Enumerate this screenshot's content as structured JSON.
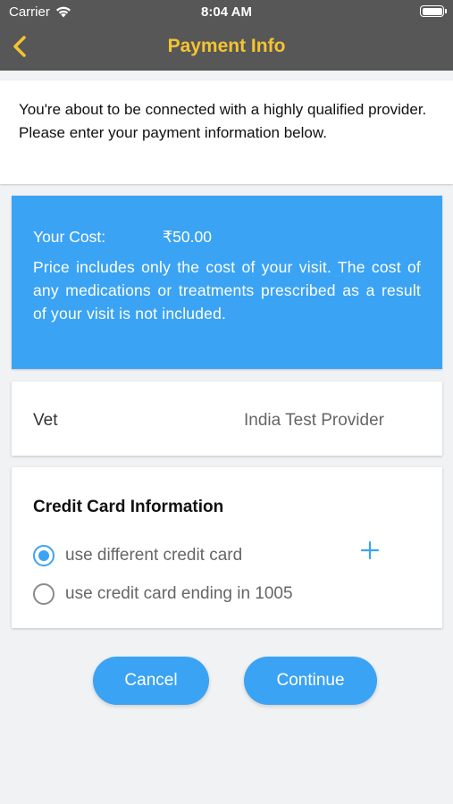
{
  "status_bar": {
    "carrier": "Carrier",
    "time": "8:04 AM"
  },
  "nav": {
    "title": "Payment Info",
    "back_icon": "chevron-left-icon",
    "title_color": "#f4c430"
  },
  "intro": {
    "text": "You're about to be connected with a highly qualified provider. Please enter your payment information below."
  },
  "cost": {
    "label": "Your Cost:",
    "amount": "₹50.00",
    "note": "Price includes only the cost of your visit. The cost of any medications or treatments prescribed as a result of your visit is not included.",
    "background": "#3ba3f4"
  },
  "vet": {
    "label": "Vet",
    "value": "India Test Provider"
  },
  "credit_card": {
    "title": "Credit Card Information",
    "options": [
      {
        "label": "use different credit card",
        "selected": true
      },
      {
        "label": "use credit card ending in 1005",
        "selected": false
      }
    ],
    "add_icon": "plus-icon"
  },
  "actions": {
    "cancel": "Cancel",
    "continue": "Continue"
  }
}
